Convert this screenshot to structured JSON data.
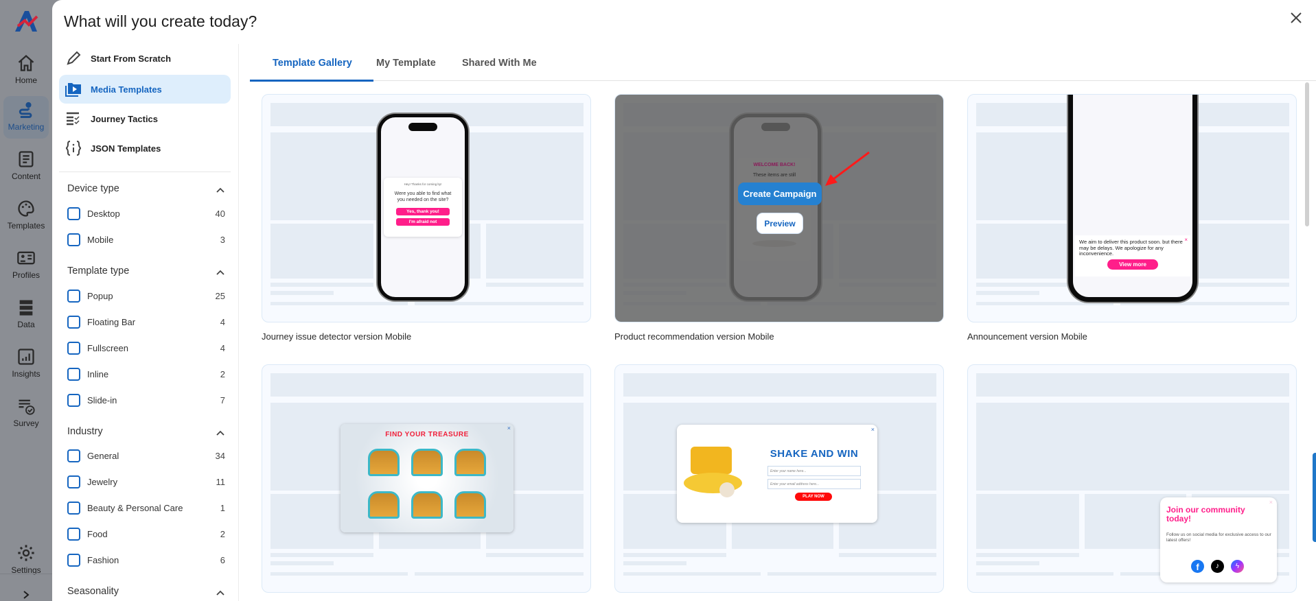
{
  "nav": {
    "items": [
      {
        "label": "Home",
        "icon": "home-icon"
      },
      {
        "label": "Marketing",
        "icon": "map-route-icon",
        "active": true
      },
      {
        "label": "Content",
        "icon": "document-icon"
      },
      {
        "label": "Templates",
        "icon": "palette-icon"
      },
      {
        "label": "Profiles",
        "icon": "id-card-icon"
      },
      {
        "label": "Data",
        "icon": "database-icon"
      },
      {
        "label": "Insights",
        "icon": "chart-icon"
      },
      {
        "label": "Survey",
        "icon": "survey-icon"
      }
    ],
    "settings": "Settings",
    "expand_icon": "chevron-right-icon"
  },
  "modal": {
    "title": "What will you create today?",
    "close_icon": "close-icon"
  },
  "menu": [
    {
      "label": "Start From Scratch",
      "icon": "pencil-icon"
    },
    {
      "label": "Media Templates",
      "icon": "media-folder-icon",
      "active": true
    },
    {
      "label": "Journey Tactics",
      "icon": "checklist-icon"
    },
    {
      "label": "JSON Templates",
      "icon": "json-braces-icon"
    }
  ],
  "filters": [
    {
      "title": "Device type",
      "items": [
        {
          "label": "Desktop",
          "count": "40"
        },
        {
          "label": "Mobile",
          "count": "3"
        }
      ]
    },
    {
      "title": "Template type",
      "items": [
        {
          "label": "Popup",
          "count": "25"
        },
        {
          "label": "Floating Bar",
          "count": "4"
        },
        {
          "label": "Fullscreen",
          "count": "4"
        },
        {
          "label": "Inline",
          "count": "2"
        },
        {
          "label": "Slide-in",
          "count": "7"
        }
      ]
    },
    {
      "title": "Industry",
      "items": [
        {
          "label": "General",
          "count": "34"
        },
        {
          "label": "Jewelry",
          "count": "11"
        },
        {
          "label": "Beauty & Personal Care",
          "count": "1"
        },
        {
          "label": "Food",
          "count": "2"
        },
        {
          "label": "Fashion",
          "count": "6"
        }
      ]
    },
    {
      "title": "Seasonality",
      "items": []
    }
  ],
  "tabs": [
    {
      "label": "Template Gallery",
      "active": true
    },
    {
      "label": "My Template"
    },
    {
      "label": "Shared With Me"
    }
  ],
  "cards": [
    {
      "label": "Journey issue detector version Mobile",
      "popup": {
        "greeting": "Hey! Thanks for coming by!",
        "question": "Were you able to find what you needed on the site?",
        "yes": "Yes, thank you!",
        "no": "I'm afraid not"
      }
    },
    {
      "label": "Product recommendation version Mobile",
      "popup": {
        "heading": "WELCOME BACK!",
        "text": "These items are still"
      },
      "hover": {
        "create": "Create Campaign",
        "preview": "Preview"
      }
    },
    {
      "label": "Announcement version Mobile",
      "popup": {
        "text": "We aim to deliver this product soon. but there may be delays. We apologize for any inconvenience.",
        "button": "View more"
      }
    },
    {
      "popup": {
        "heading": "FIND YOUR TREASURE"
      }
    },
    {
      "popup": {
        "heading": "SHAKE AND WIN",
        "name_placeholder": "Enter your name here...",
        "email_placeholder": "Enter your email address here...",
        "button": "PLAY NOW"
      }
    },
    {
      "popup": {
        "heading": "Join our community today!",
        "text": "Follow us on social media for exclusive access to our latest offers!",
        "icons": [
          "facebook-icon",
          "tiktok-icon",
          "messenger-icon"
        ]
      }
    }
  ],
  "colors": {
    "accent": "#1565c0",
    "pink": "#ff1e8a",
    "create_campaign": "#2581d1"
  }
}
